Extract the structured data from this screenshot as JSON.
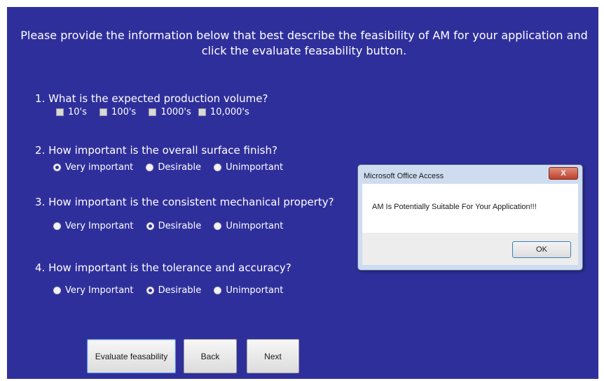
{
  "intro_text": "Please provide the information below that best describe the feasibility of AM for your application and click the evaluate feasability button.",
  "questions": [
    {
      "label": "1. What is the expected production volume?",
      "options": [
        {
          "label": "10's",
          "checked": false
        },
        {
          "label": "100's",
          "checked": false
        },
        {
          "label": "1000's",
          "checked": false
        },
        {
          "label": "10,000's",
          "checked": false
        }
      ]
    },
    {
      "label": "2. How important is the overall surface finish?",
      "options": [
        {
          "label": "Very important",
          "selected": true
        },
        {
          "label": "Desirable",
          "selected": false
        },
        {
          "label": "Unimportant",
          "selected": false
        }
      ]
    },
    {
      "label": "3. How important is the consistent mechanical property?",
      "options": [
        {
          "label": "Very Important",
          "selected": false
        },
        {
          "label": "Desirable",
          "selected": true
        },
        {
          "label": "Unimportant",
          "selected": false
        }
      ]
    },
    {
      "label": "4. How important is the tolerance and accuracy?",
      "options": [
        {
          "label": "Very Important",
          "selected": false
        },
        {
          "label": "Desirable",
          "selected": true
        },
        {
          "label": "Unimportant",
          "selected": false
        }
      ]
    }
  ],
  "buttons": {
    "evaluate": "Evaluate feasability",
    "back": "Back",
    "next": "Next"
  },
  "dialog": {
    "title": "Microsoft Office Access",
    "close": "X",
    "message": "AM Is Potentially Suitable For Your Application!!!",
    "ok": "OK"
  },
  "colors": {
    "panel_background": "#2f2f9c",
    "text": "#ffffff"
  }
}
